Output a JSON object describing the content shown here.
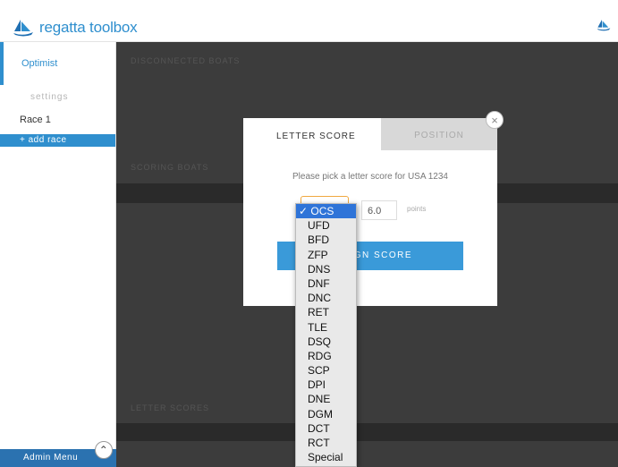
{
  "header": {
    "app_name": "regatta toolbox"
  },
  "sidebar": {
    "event": "Optimist",
    "settings": "settings",
    "race": "Race 1",
    "add_race": "+ add race",
    "admin_menu": "Admin Menu"
  },
  "background": {
    "section1": "DISCONNECTED BOATS",
    "section2": "SCORING BOATS",
    "section3": "LETTER SCORES"
  },
  "modal": {
    "tab_letter": "LETTER SCORE",
    "tab_position": "POSITION",
    "prompt": "Please pick a letter score for USA 1234",
    "points_value": "6.0",
    "points_label": "points",
    "assign_button": "ASSIGN SCORE",
    "close": "×"
  },
  "dropdown": {
    "selected": "OCS",
    "options": [
      "OCS",
      "UFD",
      "BFD",
      "ZFP",
      "DNS",
      "DNF",
      "DNC",
      "RET",
      "TLE",
      "DSQ",
      "RDG",
      "SCP",
      "DPI",
      "DNE",
      "DGM",
      "DCT",
      "RCT",
      "Special"
    ]
  },
  "colors": {
    "brand": "#2f8fce",
    "button": "#3a9ad9",
    "select_highlight": "#2f74d8"
  }
}
